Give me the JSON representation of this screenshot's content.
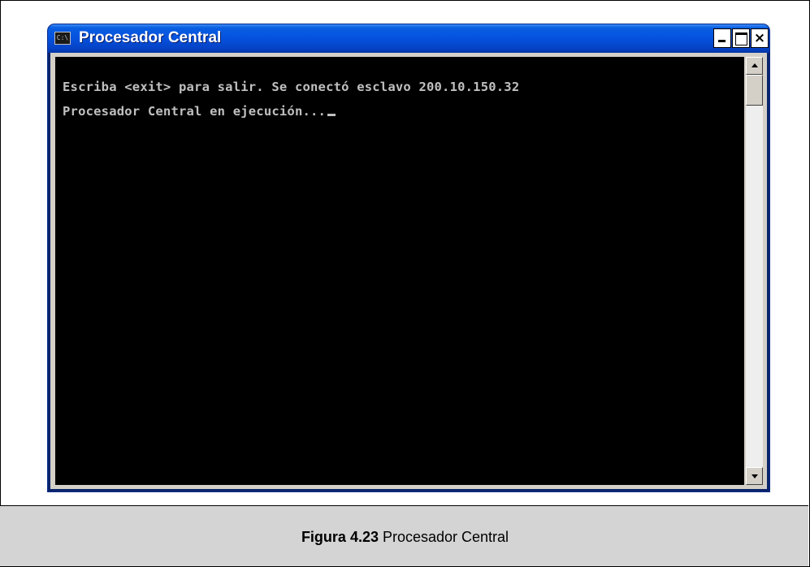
{
  "window": {
    "title": "Procesador Central",
    "icon": "cmd-console-icon",
    "icon_glyph": "C:\\",
    "controls": [
      "minimize",
      "maximize",
      "close"
    ],
    "close_glyph": "×"
  },
  "console": {
    "lines": [
      "Escriba <exit> para salir. Se conectó esclavo 200.10.150.32",
      "Procesador Central en ejecución..."
    ]
  },
  "caption": {
    "label": "Figura 4.23",
    "text": " Procesador Central"
  }
}
